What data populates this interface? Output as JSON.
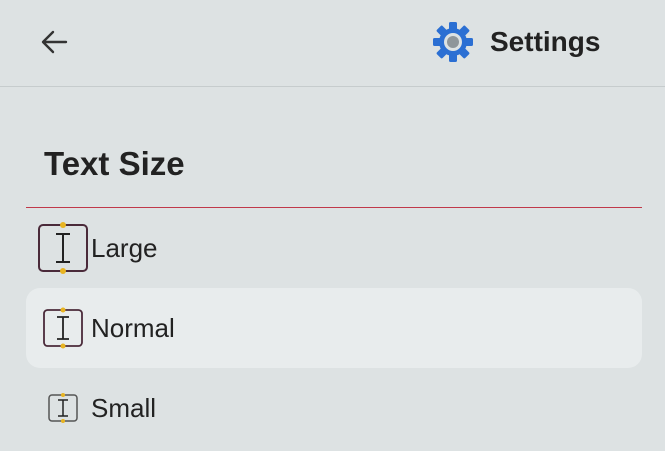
{
  "header": {
    "back_icon": "arrow-left-icon",
    "settings_icon": "gear-icon",
    "title": "Settings",
    "accent_color": "#2b6fd3"
  },
  "section": {
    "title": "Text Size",
    "divider_color": "#c0394a"
  },
  "options": [
    {
      "label": "Large",
      "icon": "text-cursor-icon",
      "selected": false
    },
    {
      "label": "Normal",
      "icon": "text-cursor-icon",
      "selected": true
    },
    {
      "label": "Small",
      "icon": "text-cursor-icon",
      "selected": false
    }
  ]
}
